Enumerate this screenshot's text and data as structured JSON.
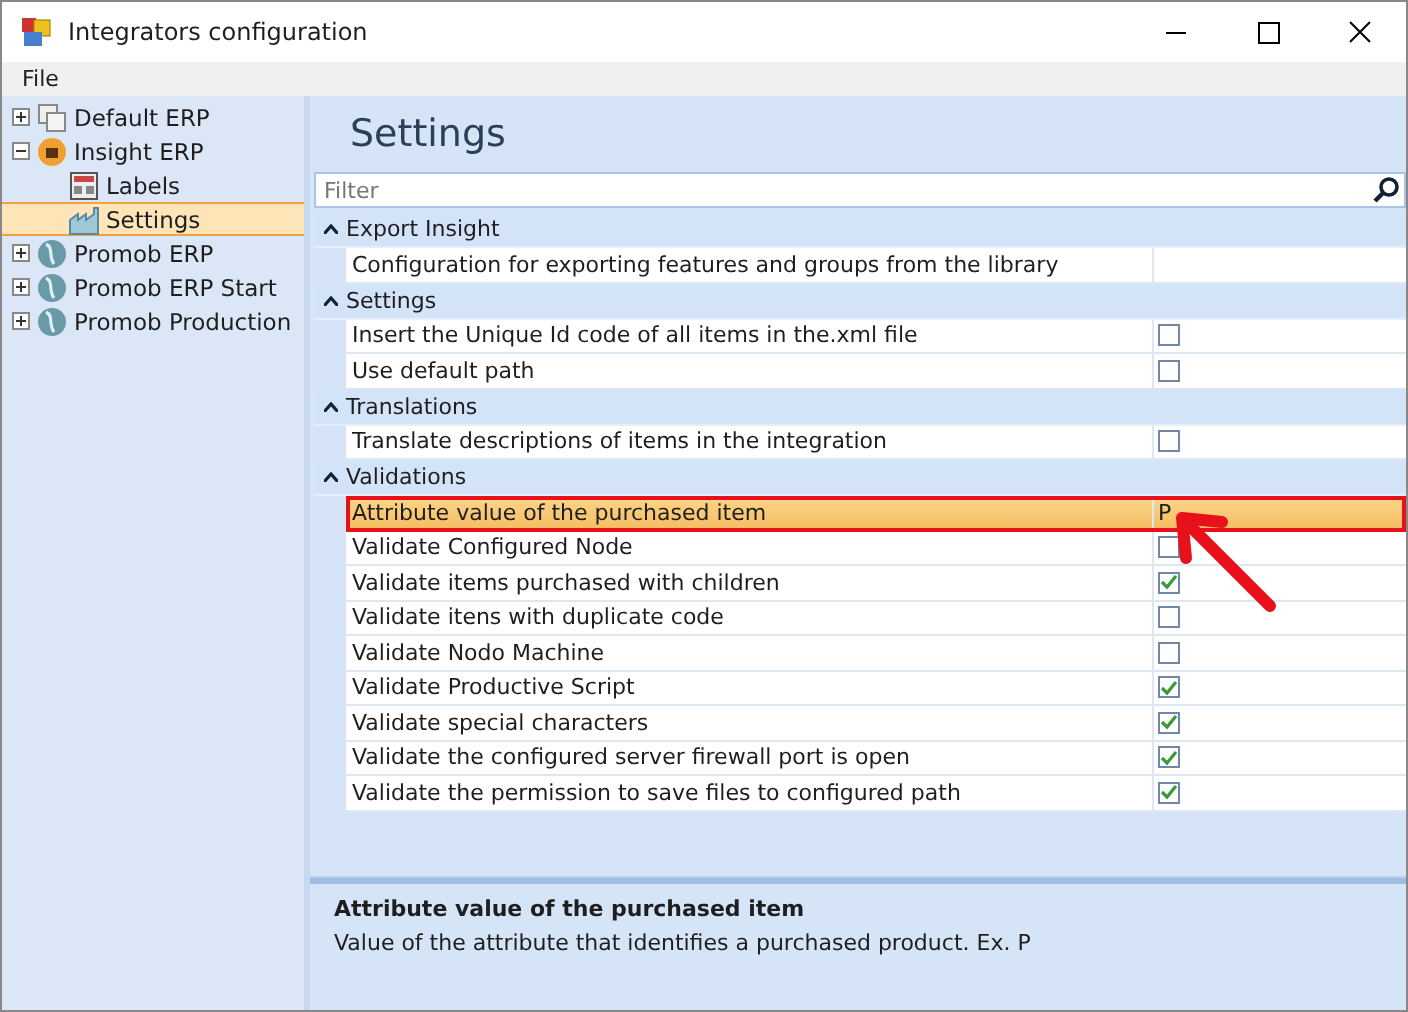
{
  "window": {
    "title": "Integrators configuration"
  },
  "menu": [
    "File"
  ],
  "tree": [
    {
      "label": "Default ERP",
      "expanded": false,
      "selected": false
    },
    {
      "label": "Insight ERP",
      "expanded": true,
      "selected": false,
      "children": [
        {
          "label": "Labels",
          "selected": false
        },
        {
          "label": "Settings",
          "selected": true
        }
      ]
    },
    {
      "label": "Promob ERP",
      "expanded": false,
      "selected": false
    },
    {
      "label": "Promob ERP Start",
      "expanded": false,
      "selected": false
    },
    {
      "label": "Promob Production",
      "expanded": false,
      "selected": false
    }
  ],
  "heading": "Settings",
  "filter": {
    "placeholder": "Filter"
  },
  "groups": [
    {
      "title": "Export Insight",
      "expanded": true,
      "rows": [
        {
          "label": "Configuration for exporting features and groups from the library",
          "kind": "text",
          "value": "",
          "selected": false,
          "highlighted": false
        }
      ]
    },
    {
      "title": "Settings",
      "expanded": true,
      "rows": [
        {
          "label": "Insert the Unique Id code of all items in the.xml file",
          "kind": "checkbox",
          "checked": false,
          "selected": false,
          "highlighted": false
        },
        {
          "label": "Use default path",
          "kind": "checkbox",
          "checked": false,
          "selected": false,
          "highlighted": false
        }
      ]
    },
    {
      "title": "Translations",
      "expanded": true,
      "rows": [
        {
          "label": "Translate descriptions of items in the integration",
          "kind": "checkbox",
          "checked": false,
          "selected": false,
          "highlighted": false
        }
      ]
    },
    {
      "title": "Validations",
      "expanded": true,
      "rows": [
        {
          "label": "Attribute value of the purchased item",
          "kind": "text",
          "value": "P",
          "selected": true,
          "highlighted": true
        },
        {
          "label": "Validate Configured Node",
          "kind": "checkbox",
          "checked": false,
          "selected": false,
          "highlighted": false
        },
        {
          "label": "Validate items purchased with children",
          "kind": "checkbox",
          "checked": true,
          "selected": false,
          "highlighted": false
        },
        {
          "label": "Validate itens with duplicate code",
          "kind": "checkbox",
          "checked": false,
          "selected": false,
          "highlighted": false
        },
        {
          "label": "Validate Nodo Machine",
          "kind": "checkbox",
          "checked": false,
          "selected": false,
          "highlighted": false
        },
        {
          "label": "Validate Productive Script",
          "kind": "checkbox",
          "checked": true,
          "selected": false,
          "highlighted": false
        },
        {
          "label": "Validate special characters",
          "kind": "checkbox",
          "checked": true,
          "selected": false,
          "highlighted": false
        },
        {
          "label": "Validate the configured server firewall port is open",
          "kind": "checkbox",
          "checked": true,
          "selected": false,
          "highlighted": false
        },
        {
          "label": "Validate the permission to save files to configured path",
          "kind": "checkbox",
          "checked": true,
          "selected": false,
          "highlighted": false
        }
      ]
    }
  ],
  "description": {
    "title": "Attribute value of the purchased item",
    "text": "Value of the attribute that identifies a purchased product. Ex. P"
  }
}
